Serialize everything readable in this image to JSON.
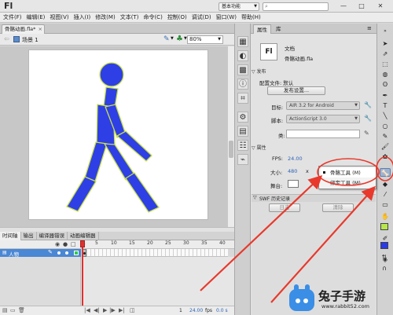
{
  "app": {
    "logo": "Fl",
    "workspace": "基本功能",
    "search_placeholder": "",
    "window_buttons": [
      "—",
      "□",
      "✕"
    ]
  },
  "menu": [
    "文件(F)",
    "编辑(E)",
    "视图(V)",
    "插入(I)",
    "修改(M)",
    "文本(T)",
    "命令(C)",
    "控制(O)",
    "调试(D)",
    "窗口(W)",
    "帮助(H)"
  ],
  "document": {
    "tab_label": "骨骼动画.fla*",
    "tab_close": "×",
    "scene_label": "场景 1",
    "zoom": "80%"
  },
  "timeline": {
    "tabs": [
      "时间轴",
      "输出",
      "编译器错误",
      "动画编辑器"
    ],
    "ruler": [
      "1",
      "5",
      "10",
      "15",
      "20",
      "25",
      "30",
      "35",
      "40"
    ],
    "layer_name": "人物",
    "footer": {
      "frame": "1",
      "fps": "24.00",
      "fps_unit": "fps",
      "time": "0.0 s"
    }
  },
  "properties": {
    "tabs": [
      "属性",
      "库"
    ],
    "doc_icon": "Fl",
    "doc_type": "文档",
    "doc_name": "骨骼动画.fla",
    "publish_section": "发布",
    "profile_label": "配置文件: 默认",
    "publish_settings_button": "发布设置...",
    "target_label": "目标:",
    "target_value": "AIR 3.2 for Android",
    "script_label": "脚本:",
    "script_value": "ActionScript 3.0",
    "class_label": "类:",
    "attributes_section": "属性",
    "fps_label": "FPS:",
    "fps_value": "24.00",
    "size_label": "大小:",
    "size_width": "480",
    "size_x": "x",
    "stage_label": "舞台:",
    "history_section": "SWF 历史记录",
    "history_log": "日志",
    "history_clear": "清除"
  },
  "context_menu": {
    "items": [
      "骨骼工具 (M)",
      "绑定工具 (M)"
    ]
  },
  "tools": {
    "stroke_color": "#b8e64b",
    "fill_color": "#2b3be8"
  },
  "watermark": {
    "text": "兔子手游",
    "url": "www.rabbit52.com"
  },
  "colors": {
    "figure_fill": "#2f3fe6",
    "figure_outline": "#c8e04a",
    "annotation_red": "#e8392c",
    "selection_blue": "#4a87d4"
  }
}
